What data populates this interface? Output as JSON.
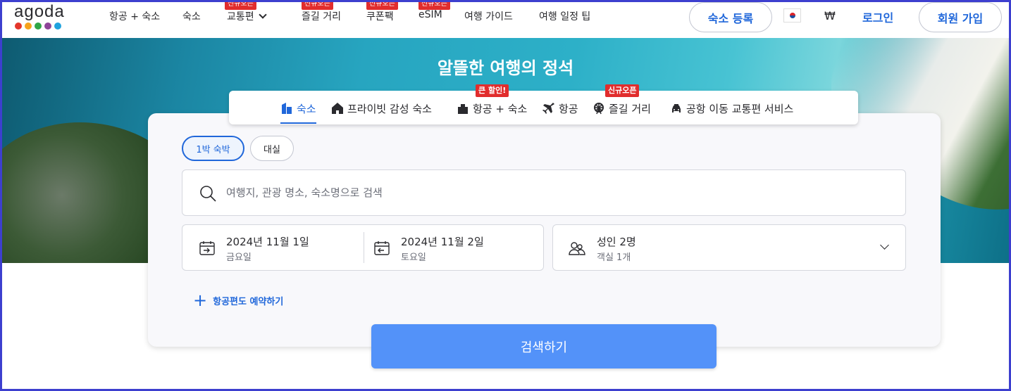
{
  "brand": {
    "name": "agoda",
    "dot_colors": [
      "#e4362b",
      "#f6a31c",
      "#2fa647",
      "#8e4598",
      "#20a3de"
    ]
  },
  "nav": {
    "items": [
      {
        "label": "항공 + 숙소"
      },
      {
        "label": "숙소"
      },
      {
        "label": "교통편",
        "badge": "신규오픈"
      },
      {
        "label": "즐길 거리",
        "badge": "신규오픈"
      },
      {
        "label": "쿠폰팩",
        "badge": "신규오픈"
      },
      {
        "label": "eSIM",
        "badge": "신규오픈"
      },
      {
        "label": "여행 가이드"
      },
      {
        "label": "여행 일정 팁"
      }
    ],
    "list_property": "숙소 등록",
    "flag_icon": "south-korea-flag-icon",
    "currency": "₩",
    "login": "로그인",
    "signup": "회원 가입"
  },
  "hero": {
    "title": "알뜰한 여행의 정석"
  },
  "tabs": [
    {
      "label": "숙소",
      "icon": "hotel-icon",
      "active": true
    },
    {
      "label": "프라이빗 감성 숙소",
      "icon": "house-icon"
    },
    {
      "label": "항공 + 숙소",
      "icon": "flight-hotel-icon",
      "badge": "큰 할인!"
    },
    {
      "label": "항공",
      "icon": "airplane-icon"
    },
    {
      "label": "즐길 거리",
      "icon": "ferris-wheel-icon",
      "badge": "신규오픈"
    },
    {
      "label": "공항 이동 교통편 서비스",
      "icon": "car-icon"
    }
  ],
  "search": {
    "stay_options": [
      "1박 숙박",
      "대실"
    ],
    "selected_stay_option": "1박 숙박",
    "destination_placeholder": "여행지, 관광 명소, 숙소명으로 검색",
    "checkin": {
      "date": "2024년 11월 1일",
      "day": "금요일"
    },
    "checkout": {
      "date": "2024년 11월 2일",
      "day": "토요일"
    },
    "guests": {
      "adults": "성인 2명",
      "rooms": "객실 1개"
    },
    "add_flight": "항공편도 예약하기",
    "submit": "검색하기"
  },
  "colors": {
    "primary": "#2067da",
    "search_button": "#5392f9",
    "badge": "#e12d2d"
  }
}
